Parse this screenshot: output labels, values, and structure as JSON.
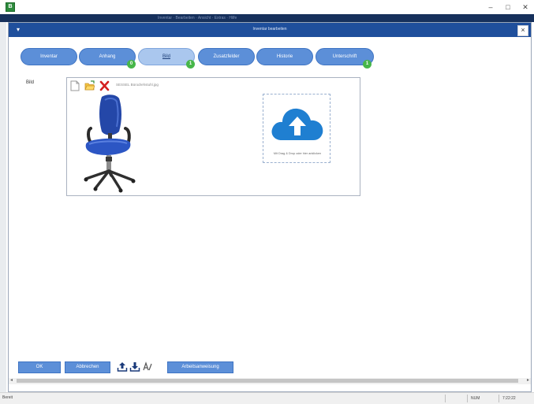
{
  "window": {
    "icon_letter": "B",
    "minimize": "–",
    "maximize": "□",
    "close": "✕"
  },
  "background": {
    "menubar_text": "Inventar · Bearbeiten · Ansicht · Extras · Hilfe"
  },
  "dialog": {
    "title": "Inventar bearbeiten",
    "menu_glyph": "▾",
    "close_glyph": "×"
  },
  "tabs": [
    {
      "label": "Inventar",
      "badge": ""
    },
    {
      "label": "Anhang",
      "badge": "0"
    },
    {
      "label": "Bild",
      "badge": "1",
      "active": true
    },
    {
      "label": "Zusatzfelder",
      "badge": ""
    },
    {
      "label": "Historie",
      "badge": ""
    },
    {
      "label": "Unterschrift",
      "badge": "1"
    }
  ],
  "image_field": {
    "label": "Bild",
    "filename": "SESSEL Bürodrehstuhl.jpg",
    "upload_hint": "Mit Drag & Drop oder hier anklicken"
  },
  "footer": {
    "ok_label": "OK",
    "cancel_label": "Abbrechen",
    "assign_label": "Arbeitsanweisung"
  },
  "status": {
    "left": "Bereit",
    "cell1": "",
    "cell2": "NUM",
    "cell3": "7:22:22"
  },
  "colors": {
    "header": "#1f4f9c",
    "tab": "#5c8fd8",
    "tab_active": "#aac7ee",
    "badge": "#47b649",
    "upload_cloud": "#1f7fd1"
  }
}
